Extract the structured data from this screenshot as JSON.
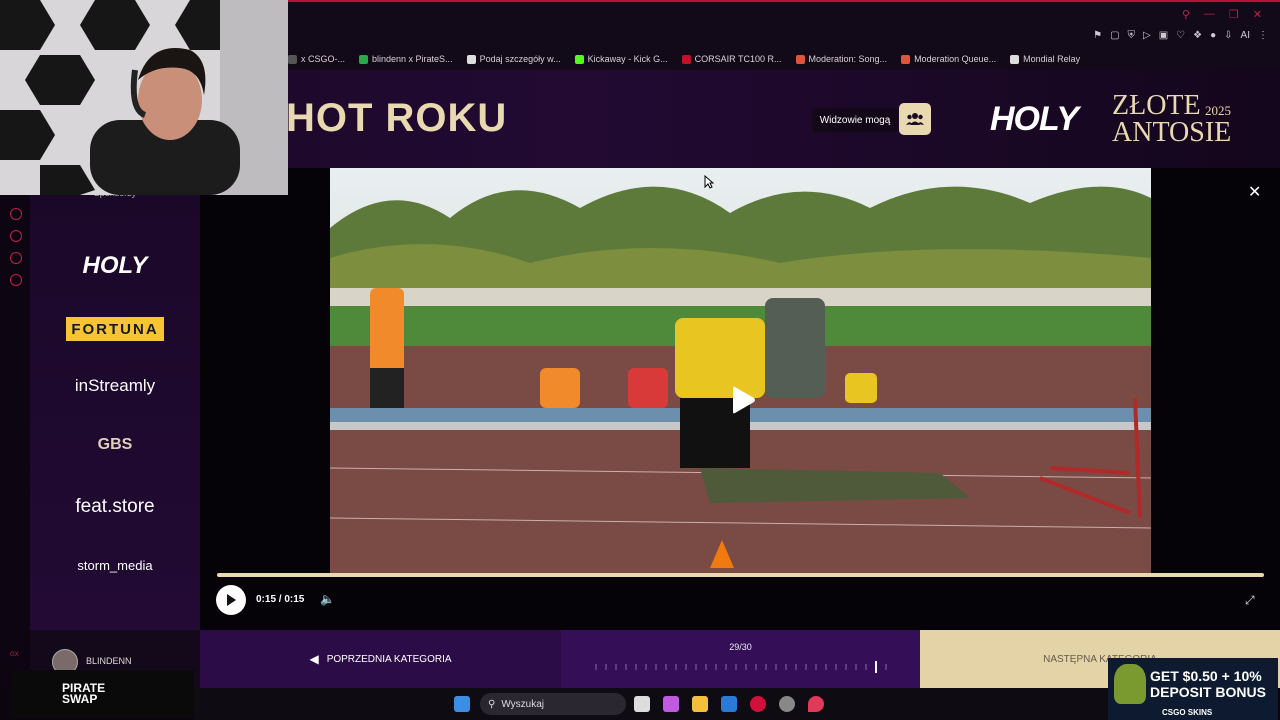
{
  "browser": {
    "bookmarks": [
      {
        "label": "x CSGO-...",
        "color": "#555555"
      },
      {
        "label": "blindenn x PirateS...",
        "color": "#2aa84a"
      },
      {
        "label": "Podaj szczegóły w...",
        "color": "#dddddd"
      },
      {
        "label": "Kickaway - Kick G...",
        "color": "#53fc18"
      },
      {
        "label": "CORSAIR TC100 R...",
        "color": "#c0102a"
      },
      {
        "label": "Moderation: Song...",
        "color": "#e0553a"
      },
      {
        "label": "Moderation Queue...",
        "color": "#e0553a"
      },
      {
        "label": "Mondial Relay",
        "color": "#dddddd"
      }
    ],
    "extension_ai_label": "AI"
  },
  "header": {
    "heading": "HOT ROKU",
    "viewers_label": "Widzowie mogą",
    "viewers_icon": "users-icon",
    "brand_logo": "HOLY",
    "award_title": "ZŁOTE ANTOSIE",
    "award_year": "2025"
  },
  "sponsors": {
    "header_partial": "Sponsorzy",
    "items": [
      "HOLY",
      "FORTUNA",
      "inStreamly",
      "GBS",
      "feat.store",
      "storm_media"
    ]
  },
  "player": {
    "time": "0:15 / 0:15",
    "progress": 1.0,
    "state": "paused"
  },
  "bottom_nav": {
    "user_name": "BLINDENN",
    "prev_label": "POPRZEDNIA KATEGORIA",
    "counter": "29/30",
    "current_index": 29,
    "total": 30,
    "next_label": "NASTĘPNA KATEGORIA"
  },
  "ads": {
    "pirate": "PIRATE SWAP",
    "csgo_line1": "GET $0.50 + 10%",
    "csgo_line2": "DEPOSIT BONUS",
    "csgo_brand": "CSGO SKINS"
  },
  "taskbar": {
    "search_placeholder": "Wyszukaj"
  },
  "colors": {
    "accent_gold": "#e8d9b0",
    "accent_purple": "#350e58",
    "browser_accent": "#c0204a"
  }
}
